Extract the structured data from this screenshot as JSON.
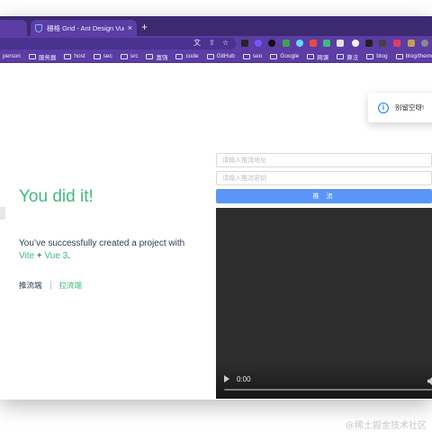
{
  "browser": {
    "tab_title": "栅格 Grid - Ant Design Vue",
    "tab_close": "×",
    "new_tab": "+",
    "bookmarks": [
      {
        "label": "person",
        "folder": false
      },
      {
        "label": "服务器",
        "folder": true
      },
      {
        "label": "host",
        "folder": true
      },
      {
        "label": "sec",
        "folder": true
      },
      {
        "label": "src",
        "folder": true
      },
      {
        "label": "富强",
        "folder": true
      },
      {
        "label": "code",
        "folder": true
      },
      {
        "label": "GitHub",
        "folder": true
      },
      {
        "label": "seo",
        "folder": true
      },
      {
        "label": "Google",
        "folder": true
      },
      {
        "label": "网课",
        "folder": true
      },
      {
        "label": "算法",
        "folder": true
      },
      {
        "label": "blog",
        "folder": true
      },
      {
        "label": "blog/theme",
        "folder": true
      }
    ],
    "colors": {
      "frame": "#3d2a70",
      "toolbar": "#5b3da4"
    }
  },
  "hero": {
    "title": "You did it!",
    "text_prefix": "You’ve successfully created a project with",
    "vite": "Vite",
    "plus": " + ",
    "vue": "Vue 3",
    "period": "."
  },
  "nav": {
    "push_link": "推流端",
    "pull_link": "拉流端"
  },
  "form": {
    "address_placeholder": "请输入推流地址",
    "key_placeholder": "请输入推流密钥",
    "push_button": "推 流"
  },
  "video": {
    "time": "0:00"
  },
  "toast": {
    "message": "别留空呀!"
  },
  "watermark": "@稀土掘金技术社区",
  "colors": {
    "accent_green": "#42b883",
    "button_blue": "#5996f8",
    "info_blue": "#1677ff"
  }
}
